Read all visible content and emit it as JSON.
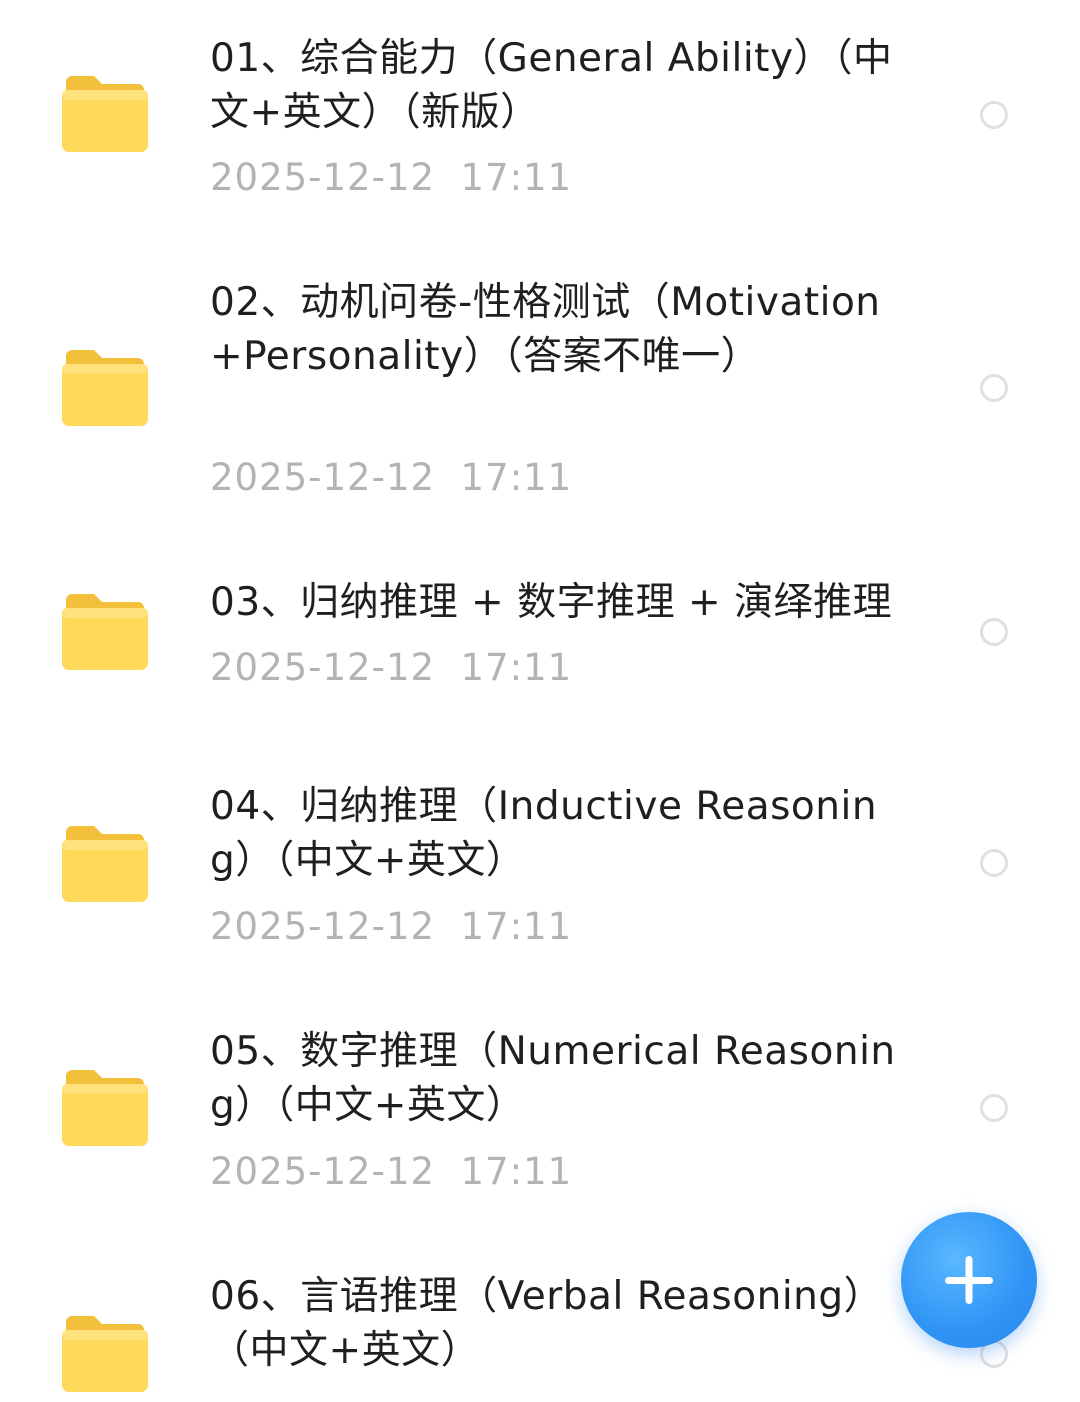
{
  "files": [
    {
      "name": "01、综合能力（General Ability）（中文+英文）（新版）",
      "date": "2025-12-12  17:11"
    },
    {
      "name": "02、动机问卷-性格测试（Motivation+Personality）（答案不唯一）",
      "date": "2025-12-12  17:11"
    },
    {
      "name": "03、归纳推理 + 数字推理 + 演绎推理",
      "date": "2025-12-12  17:11"
    },
    {
      "name": "04、归纳推理（Inductive Reasoning）（中文+英文）",
      "date": "2025-12-12  17:11"
    },
    {
      "name": "05、数字推理（Numerical Reasoning）（中文+英文）",
      "date": "2025-12-12  17:11"
    },
    {
      "name": "06、言语推理（Verbal Reasoning）（中文+英文）",
      "date": ""
    }
  ],
  "icons": {
    "folder": "folder-icon",
    "select": "radio-circle-icon",
    "add": "plus-icon"
  },
  "colors": {
    "folder_front": "#FFD95A",
    "folder_back": "#F5C43A",
    "fab": "#3A9BF7",
    "date": "#B3B3B3"
  }
}
